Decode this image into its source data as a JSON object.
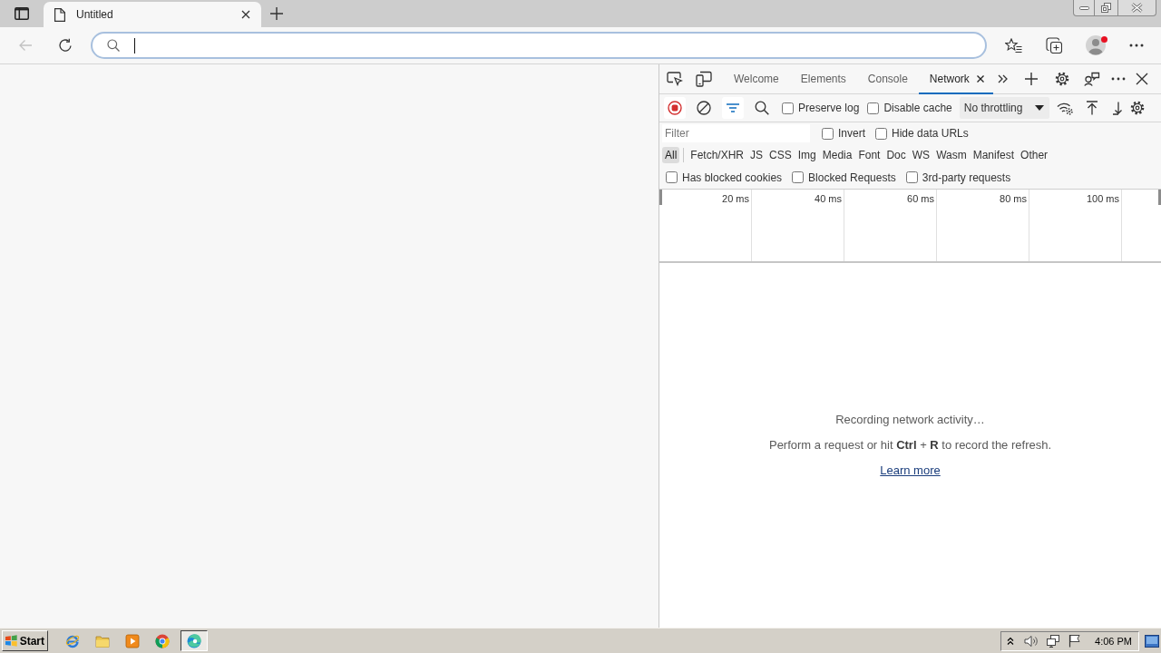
{
  "browser": {
    "tabs": [
      {
        "title": "Untitled",
        "selected": true
      }
    ],
    "back_button": {
      "disabled": true
    },
    "address_bar": {
      "focused": true
    },
    "profile": {
      "notification": true
    }
  },
  "devtools": {
    "tabs": [
      {
        "label": "Welcome",
        "selected": false,
        "closable": false
      },
      {
        "label": "Elements",
        "selected": false,
        "closable": false
      },
      {
        "label": "Console",
        "selected": false,
        "closable": false
      },
      {
        "label": "Network",
        "selected": true,
        "closable": true
      }
    ],
    "toolbar": {
      "recording": true,
      "filter_shown": true,
      "options": [
        {
          "label": "Preserve log",
          "checked": false
        },
        {
          "label": "Disable cache",
          "checked": false
        }
      ],
      "throttling": "No throttling"
    },
    "filter_bar": {
      "placeholder": "Filter",
      "options": [
        {
          "label": "Invert",
          "checked": false
        },
        {
          "label": "Hide data URLs",
          "checked": false
        }
      ]
    },
    "resource_types": [
      {
        "label": "All",
        "selected": true
      },
      {
        "label": "Fetch/XHR",
        "selected": false
      },
      {
        "label": "JS",
        "selected": false
      },
      {
        "label": "CSS",
        "selected": false
      },
      {
        "label": "Img",
        "selected": false
      },
      {
        "label": "Media",
        "selected": false
      },
      {
        "label": "Font",
        "selected": false
      },
      {
        "label": "Doc",
        "selected": false
      },
      {
        "label": "WS",
        "selected": false
      },
      {
        "label": "Wasm",
        "selected": false
      },
      {
        "label": "Manifest",
        "selected": false
      },
      {
        "label": "Other",
        "selected": false
      }
    ],
    "request_filters": [
      {
        "label": "Has blocked cookies",
        "checked": false
      },
      {
        "label": "Blocked Requests",
        "checked": false
      },
      {
        "label": "3rd-party requests",
        "checked": false
      }
    ],
    "overview": {
      "ticks": [
        "20 ms",
        "40 ms",
        "60 ms",
        "80 ms",
        "100 ms"
      ]
    },
    "empty_state": {
      "title": "Recording network activity…",
      "hint": "Perform a request or hit **Ctrl** + **R** to record the refresh.",
      "link": "Learn more"
    }
  },
  "taskbar": {
    "start": "Start",
    "pinned": [
      {
        "selected": false
      },
      {
        "selected": false
      },
      {
        "selected": false
      },
      {
        "selected": false
      },
      {
        "selected": true
      }
    ],
    "clock": "4:06 PM"
  }
}
